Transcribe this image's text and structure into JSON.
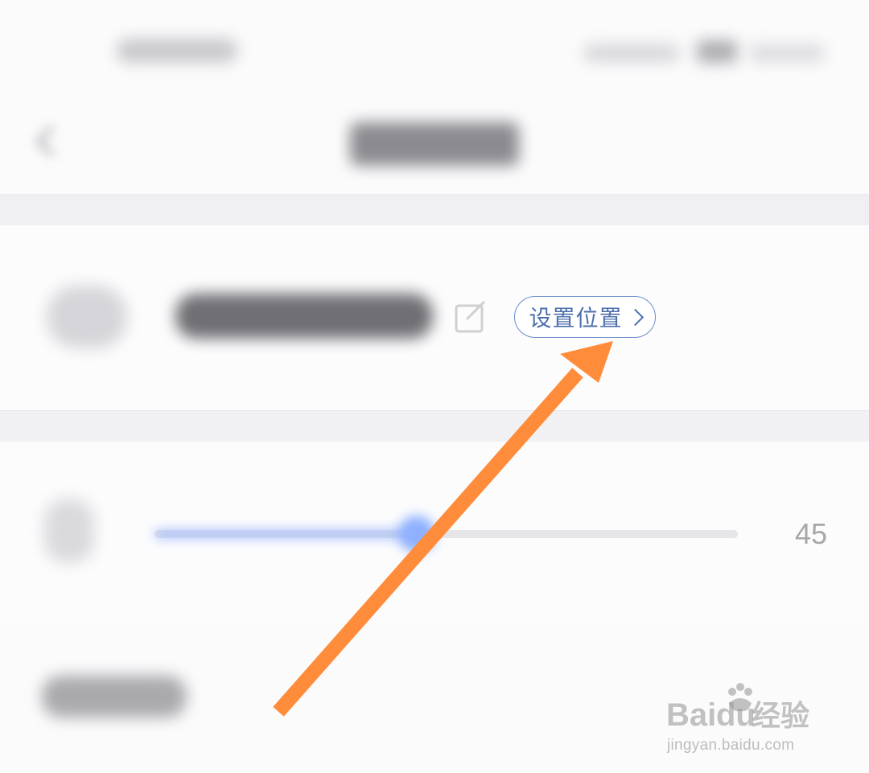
{
  "device": {
    "set_location_label": "设置位置"
  },
  "slider": {
    "value_label": "45",
    "value": 45,
    "fill_fraction": 0.45
  },
  "watermark": {
    "brand": "Baidu经验",
    "url": "jingyan.baidu.com"
  },
  "colors": {
    "accent": "#4d6fae",
    "slider_fill": "#9fb8ff",
    "arrow": "#ff8c3a"
  }
}
